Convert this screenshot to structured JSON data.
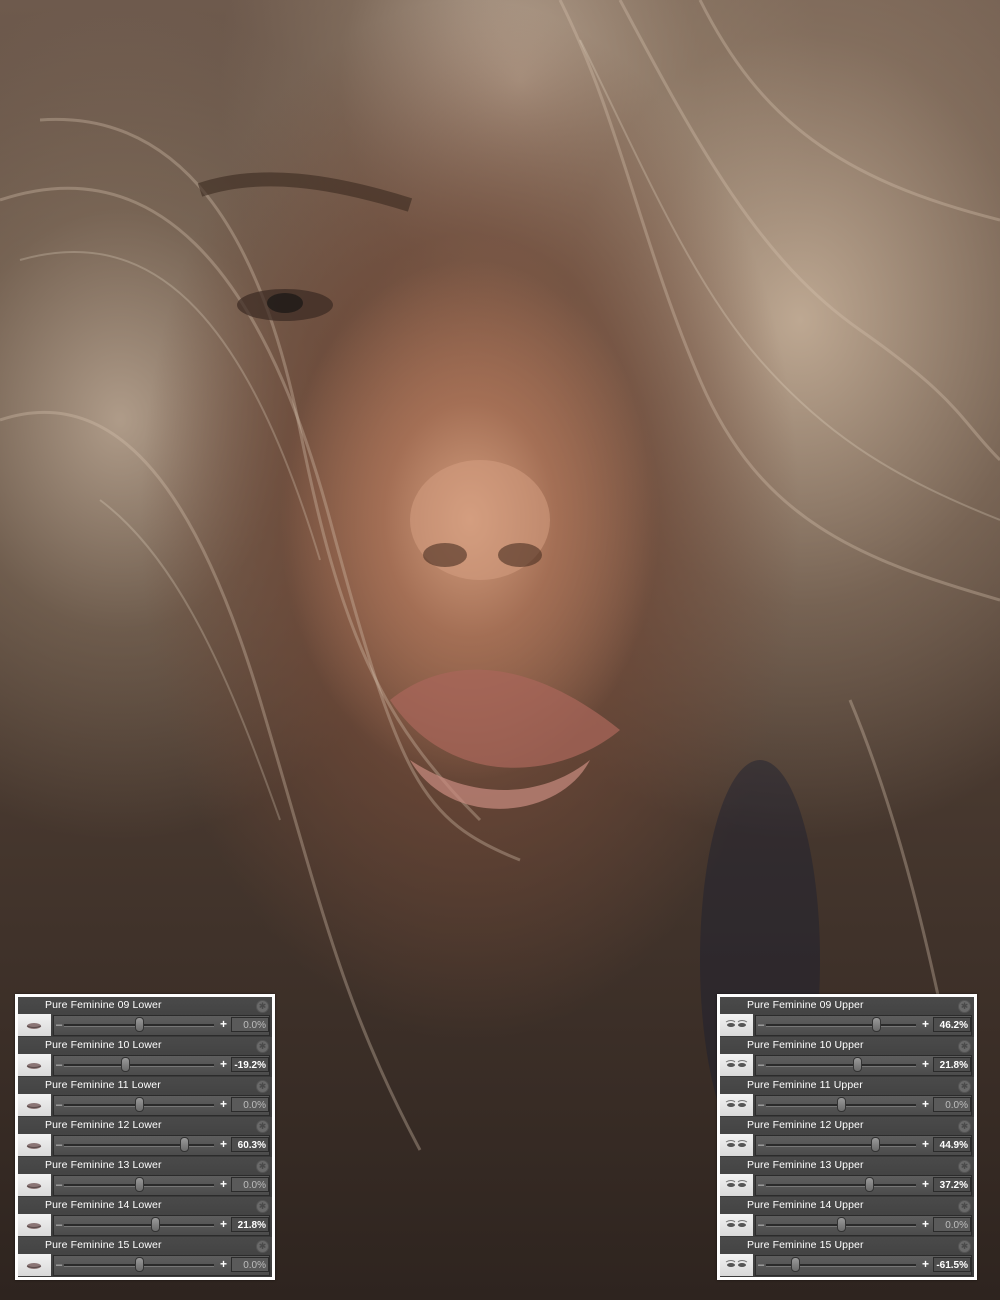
{
  "left_panel": {
    "items": [
      {
        "label": "Pure Feminine 09 Lower",
        "value": "0.0%",
        "level": 0.0
      },
      {
        "label": "Pure Feminine 10 Lower",
        "value": "-19.2%",
        "level": -19.2
      },
      {
        "label": "Pure Feminine 11 Lower",
        "value": "0.0%",
        "level": 0.0
      },
      {
        "label": "Pure Feminine 12 Lower",
        "value": "60.3%",
        "level": 60.3
      },
      {
        "label": "Pure Feminine 13 Lower",
        "value": "0.0%",
        "level": 0.0
      },
      {
        "label": "Pure Feminine 14 Lower",
        "value": "21.8%",
        "level": 21.8
      },
      {
        "label": "Pure Feminine 15 Lower",
        "value": "0.0%",
        "level": 0.0
      }
    ]
  },
  "right_panel": {
    "items": [
      {
        "label": "Pure Feminine 09 Upper",
        "value": "46.2%",
        "level": 46.2
      },
      {
        "label": "Pure Feminine 10 Upper",
        "value": "21.8%",
        "level": 21.8
      },
      {
        "label": "Pure Feminine 11 Upper",
        "value": "0.0%",
        "level": 0.0
      },
      {
        "label": "Pure Feminine 12 Upper",
        "value": "44.9%",
        "level": 44.9
      },
      {
        "label": "Pure Feminine 13 Upper",
        "value": "37.2%",
        "level": 37.2
      },
      {
        "label": "Pure Feminine 14 Upper",
        "value": "0.0%",
        "level": 0.0
      },
      {
        "label": "Pure Feminine 15 Upper",
        "value": "-61.5%",
        "level": -61.5
      }
    ]
  },
  "icons": {
    "gear": "gear-icon",
    "lower_thumb": "mouth-thumbnail-icon",
    "upper_thumb": "eyes-thumbnail-icon",
    "minus": "minus-icon",
    "plus": "plus-icon"
  },
  "colors": {
    "panel_border": "#ffffff",
    "panel_bg": "#3a3a3a",
    "active_value": "#ffffff",
    "inactive_value": "#bdbdbd"
  }
}
